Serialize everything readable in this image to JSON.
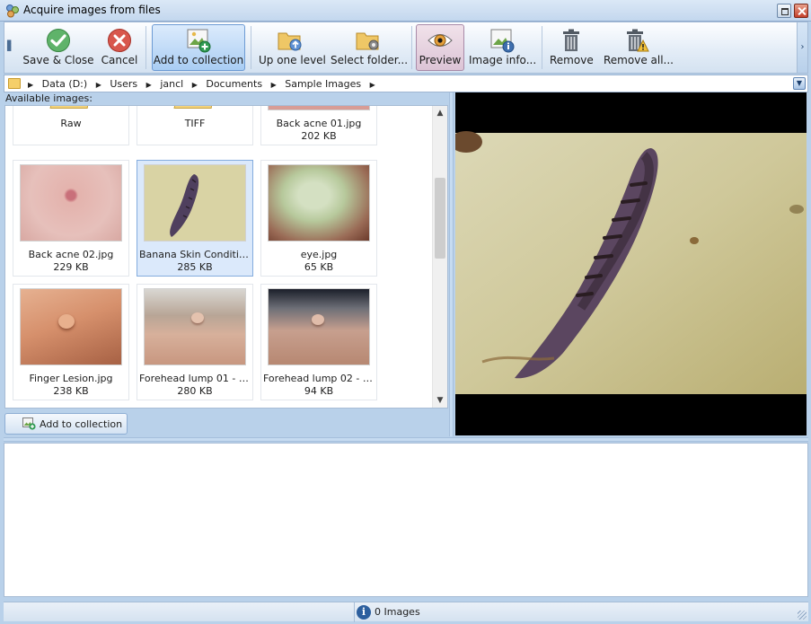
{
  "window": {
    "title": "Acquire images from files"
  },
  "toolbar": {
    "save_close": "Save & Close",
    "cancel": "Cancel",
    "add_to_collection": "Add to collection",
    "up_one_level": "Up one level",
    "select_folder": "Select folder...",
    "preview": "Preview",
    "image_info": "Image info...",
    "remove": "Remove",
    "remove_all": "Remove all..."
  },
  "path": {
    "crumbs": [
      "Data (D:)",
      "Users",
      "jancl",
      "Documents",
      "Sample Images"
    ]
  },
  "available_label": "Available images:",
  "images": [
    {
      "name": "Raw",
      "size": ""
    },
    {
      "name": "TIFF",
      "size": ""
    },
    {
      "name": "Back acne 01.jpg",
      "size": "202 KB"
    },
    {
      "name": "Back acne 02.jpg",
      "size": "229 KB"
    },
    {
      "name": "Banana Skin Condition...",
      "size": "285 KB"
    },
    {
      "name": "eye.jpg",
      "size": "65 KB"
    },
    {
      "name": "Finger Lesion.jpg",
      "size": "238 KB"
    },
    {
      "name": "Forehead lump 01 - lar...",
      "size": "280 KB"
    },
    {
      "name": "Forehead lump 02 - m...",
      "size": "94 KB"
    }
  ],
  "add_button": "Add to collection",
  "status": {
    "text": "0 Images"
  },
  "colors": {
    "accent": "#a9cdf3",
    "window_frame": "#b9d1ea",
    "toolbar_top": "#fdfeff"
  }
}
